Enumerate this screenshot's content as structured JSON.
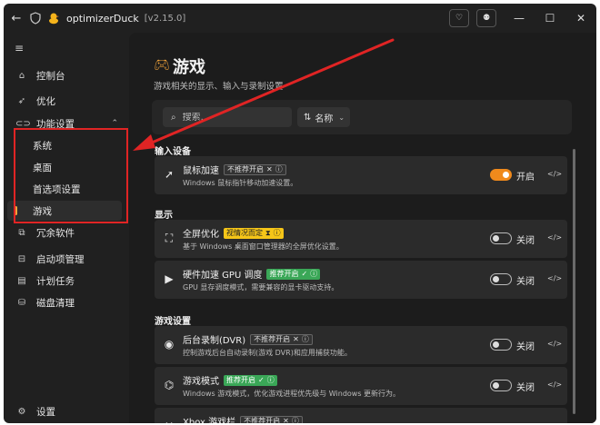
{
  "titlebar": {
    "back_icon": "back-arrow-icon",
    "app_name": "optimizerDuck",
    "version": "[v2.15.0]"
  },
  "sidebar": {
    "items": [
      {
        "label": "控制台",
        "icon": "home-icon"
      },
      {
        "label": "优化",
        "icon": "rocket-icon"
      },
      {
        "label": "功能设置",
        "icon": "toggle-icon"
      },
      {
        "label": "冗余软件",
        "icon": "package-icon"
      },
      {
        "label": "启动项管理",
        "icon": "startup-icon"
      },
      {
        "label": "计划任务",
        "icon": "calendar-icon"
      },
      {
        "label": "磁盘清理",
        "icon": "disk-icon"
      }
    ],
    "sub_items": [
      {
        "label": "系统"
      },
      {
        "label": "桌面"
      },
      {
        "label": "首选项设置"
      },
      {
        "label": "游戏",
        "active": true
      }
    ],
    "settings_label": "设置"
  },
  "main": {
    "title": "游戏",
    "subtitle": "游戏相关的显示、输入与录制设置",
    "search_placeholder": "搜索...",
    "sort_label": "名称",
    "sections": [
      {
        "label": "输入设备"
      },
      {
        "label": "显示"
      },
      {
        "label": "游戏设置"
      }
    ],
    "cards": [
      {
        "title": "鼠标加速",
        "badge": "不推荐开启",
        "badge_color": "gray",
        "desc": "Windows 鼠标指针移动加速设置。",
        "state": "开启",
        "on": true
      },
      {
        "title": "全屏优化",
        "badge": "视情况而定",
        "badge_color": "yellow",
        "desc": "基于 Windows 桌面窗口管理器的全屏优化设置。",
        "state": "关闭",
        "on": false
      },
      {
        "title": "硬件加速 GPU 调度",
        "badge": "推荐开启",
        "badge_color": "green",
        "desc": "GPU 显存调度模式，需要兼容的显卡驱动支持。",
        "state": "关闭",
        "on": false
      },
      {
        "title": "后台录制(DVR)",
        "badge": "不推荐开启",
        "badge_color": "gray",
        "desc": "控制游戏后台自动录制(游戏 DVR)和应用捕获功能。",
        "state": "关闭",
        "on": false
      },
      {
        "title": "游戏模式",
        "badge": "推荐开启",
        "badge_color": "green",
        "desc": "Windows 游戏模式，优化游戏进程优先级与 Windows 更新行为。",
        "state": "关闭",
        "on": false
      },
      {
        "title": "Xbox 游戏栏",
        "badge": "不推荐开启",
        "badge_color": "gray",
        "desc": "",
        "state": "",
        "on": false
      }
    ]
  },
  "colors": {
    "accent": "#f08a1c",
    "highlight_box": "#e02424",
    "background": "#202020"
  }
}
